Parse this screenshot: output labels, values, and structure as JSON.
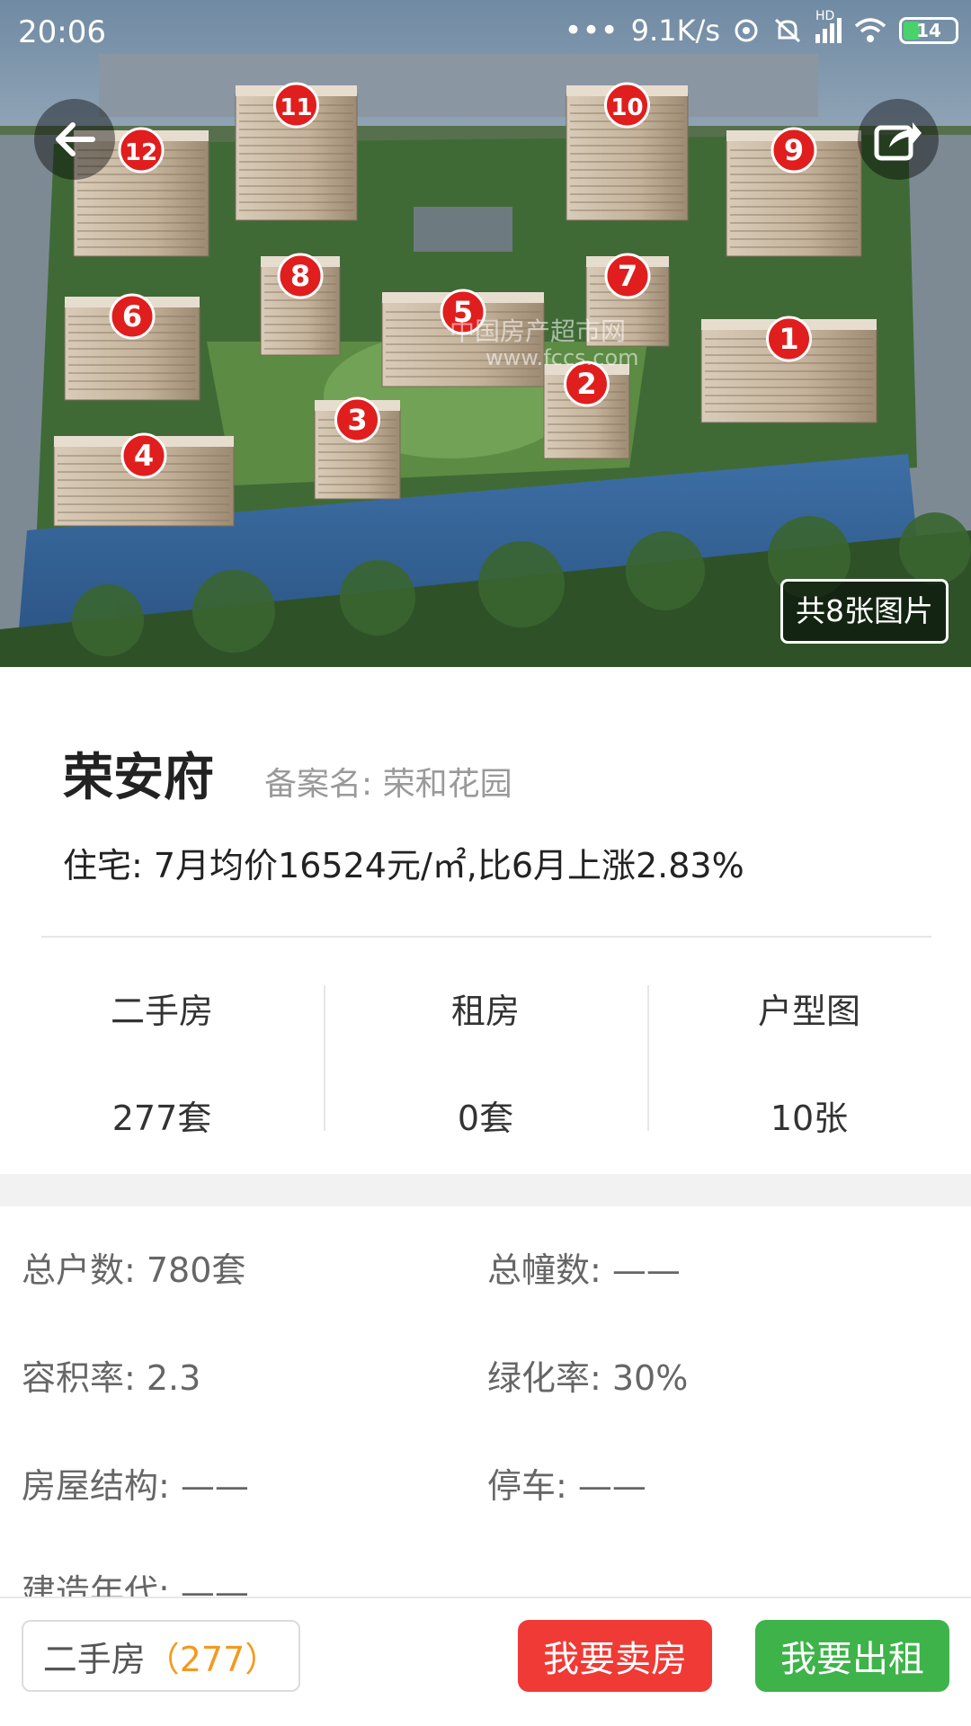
{
  "status_bar": {
    "time": "20:06",
    "dots": "•••",
    "net_speed": "9.1K/s",
    "network_label": "HD",
    "battery": "14"
  },
  "hero": {
    "photo_count": "共8张图片",
    "watermark_text": "中国房产超市网",
    "watermark_url": "www.fccs.com",
    "building_numbers": [
      "1",
      "2",
      "3",
      "4",
      "5",
      "6",
      "7",
      "8",
      "9",
      "10",
      "11",
      "12"
    ]
  },
  "project": {
    "name": "荣安府",
    "record_name": "备案名: 荣和花园",
    "price_line": "住宅: 7月均价16524元/㎡,比6月上涨2.83%"
  },
  "stats": [
    {
      "label": "二手房",
      "value": "277套"
    },
    {
      "label": "租房",
      "value": "0套"
    },
    {
      "label": "户型图",
      "value": "10张"
    }
  ],
  "info": [
    {
      "text": "总户数: 780套"
    },
    {
      "text": "总幢数: ——"
    },
    {
      "text": "容积率: 2.3"
    },
    {
      "text": "绿化率: 30%"
    },
    {
      "text": "房屋结构: ——"
    },
    {
      "text": "停车: ——"
    },
    {
      "text": "建造年代: ——"
    }
  ],
  "bottom": {
    "resale_label": "二手房",
    "resale_count": "（277）",
    "sell_button": "我要卖房",
    "rent_button": "我要出租"
  },
  "colors": {
    "sell": "#f03a35",
    "rent": "#3db34a",
    "count_accent": "#f39a1e",
    "marker": "#e01e1e"
  }
}
